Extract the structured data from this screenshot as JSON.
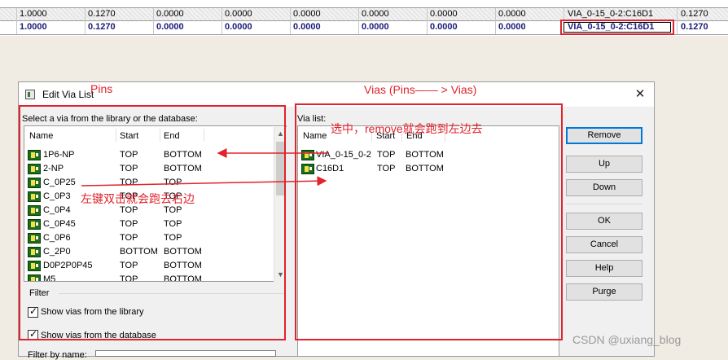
{
  "sheet": {
    "row1": [
      "1.0000",
      "0.1270",
      "0.0000",
      "0.0000",
      "0.0000",
      "0.0000",
      "0.0000",
      "0.0000",
      "VIA_0-15_0-2:C16D1",
      "0.1270"
    ],
    "row2": [
      "1.0000",
      "0.1270",
      "0.0000",
      "0.0000",
      "0.0000",
      "0.0000",
      "0.0000",
      "0.0000",
      "VIA_0-15_0-2:C16D1",
      "0.1270"
    ]
  },
  "dialog": {
    "title": "Edit Via List",
    "close_glyph": "✕",
    "library_label": "Select a via from the library or the database:",
    "via_list_label": "Via list:",
    "columns": {
      "name": "Name",
      "start": "Start",
      "end": "End"
    },
    "library_items": [
      {
        "name": "1P6-NP",
        "start": "TOP",
        "end": "BOTTOM"
      },
      {
        "name": "2-NP",
        "start": "TOP",
        "end": "BOTTOM"
      },
      {
        "name": "C_0P25",
        "start": "TOP",
        "end": "TOP"
      },
      {
        "name": "C_0P3",
        "start": "TOP",
        "end": "TOP"
      },
      {
        "name": "C_0P4",
        "start": "TOP",
        "end": "TOP"
      },
      {
        "name": "C_0P45",
        "start": "TOP",
        "end": "TOP"
      },
      {
        "name": "C_0P6",
        "start": "TOP",
        "end": "TOP"
      },
      {
        "name": "C_2P0",
        "start": "BOTTOM",
        "end": "BOTTOM"
      },
      {
        "name": "D0P2P0P45",
        "start": "TOP",
        "end": "BOTTOM"
      },
      {
        "name": "M5",
        "start": "TOP",
        "end": "BOTTOM"
      }
    ],
    "via_items": [
      {
        "name": "VIA_0-15_0-2",
        "start": "TOP",
        "end": "BOTTOM"
      },
      {
        "name": "C16D1",
        "start": "TOP",
        "end": "BOTTOM"
      }
    ],
    "filter_label": "Filter",
    "show_library": "Show vias from the library",
    "show_database": "Show vias from the database",
    "filter_by_name": "Filter by name:",
    "buttons": {
      "remove": "Remove",
      "up": "Up",
      "down": "Down",
      "ok": "OK",
      "cancel": "Cancel",
      "help": "Help",
      "purge": "Purge"
    }
  },
  "annotations": {
    "pins": "Pins",
    "vias": "Vias (Pins—— > Vias)",
    "remove_note": "选中，remove就会跑到左边去",
    "doubleclick_note": "左键双击就会跑去右边",
    "accent_color": "#e0232c"
  },
  "watermark": "CSDN @uxiang_blog"
}
